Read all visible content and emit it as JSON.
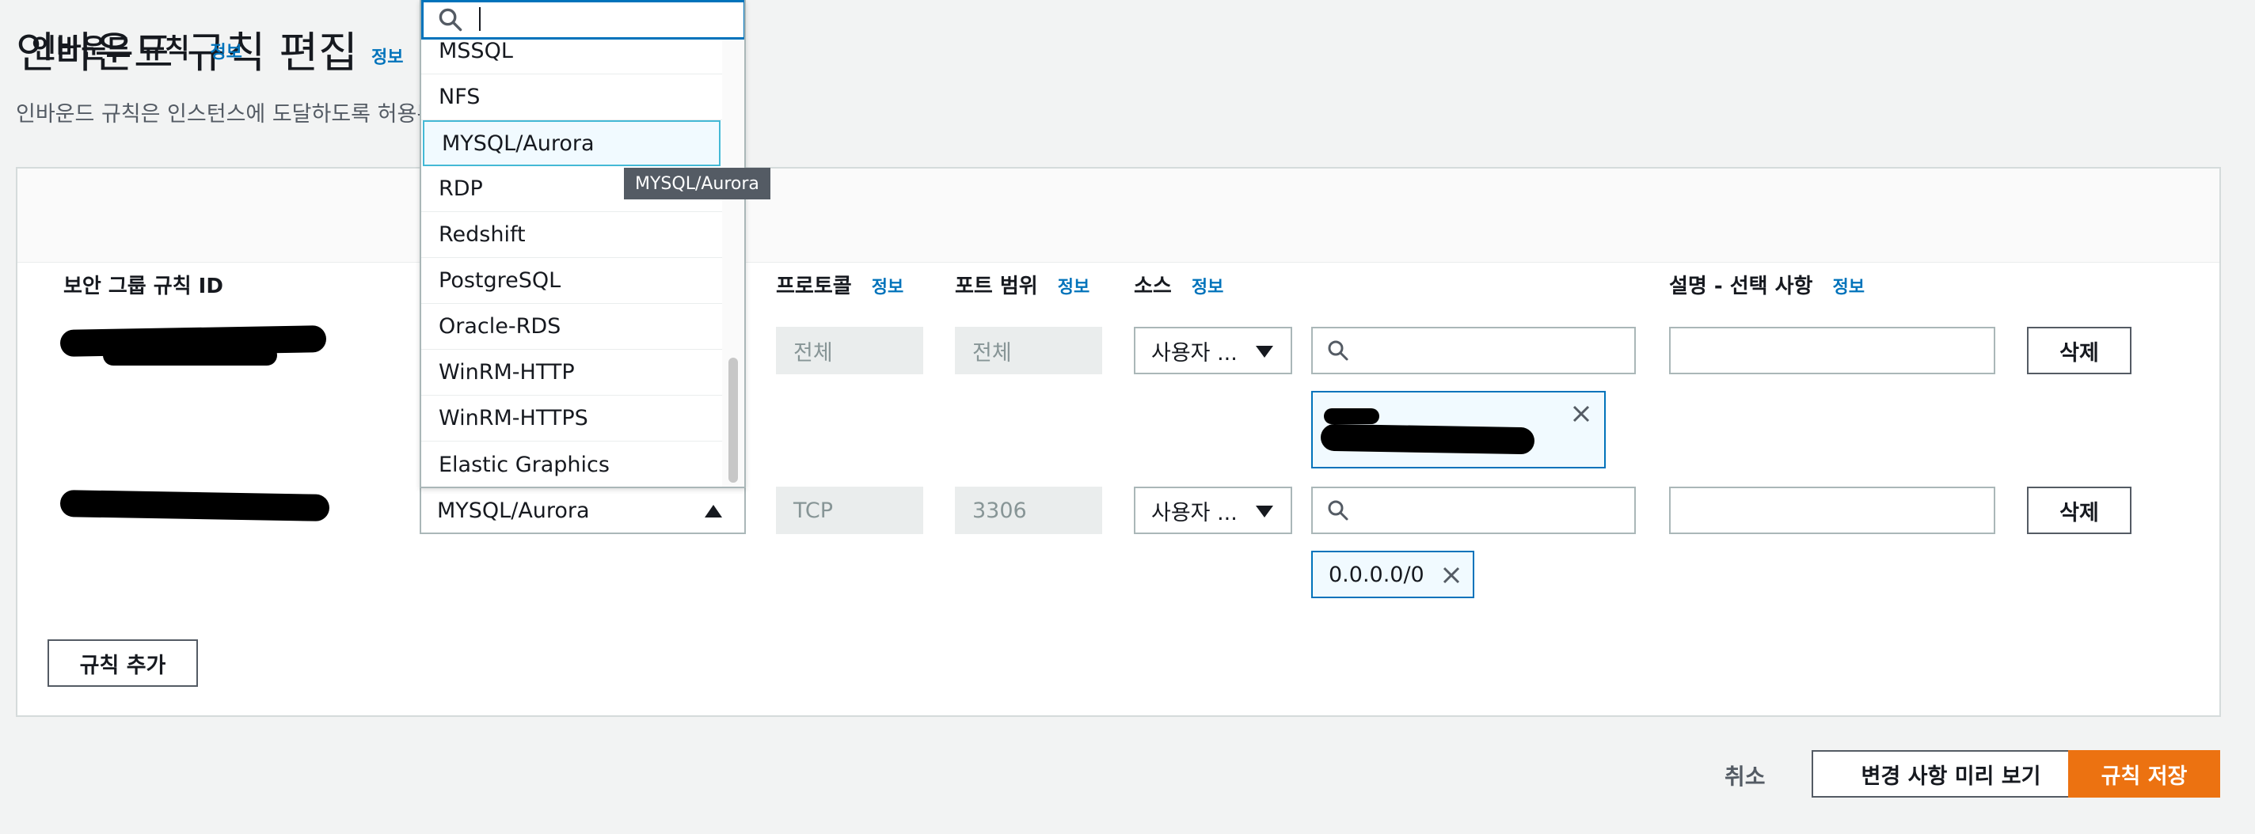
{
  "page": {
    "title": "인바운드 규칙 편집",
    "title_info": "정보",
    "description": "인바운드 규칙은 인스턴스에 도달하도록 허용된"
  },
  "panel": {
    "title": "인바운드 규칙",
    "title_info": "정보"
  },
  "columns": {
    "rule_id": "보안 그룹 규칙 ID",
    "protocol": "프로토콜",
    "protocol_info": "정보",
    "port_range": "포트 범위",
    "port_range_info": "정보",
    "source": "소스",
    "source_info": "정보",
    "description": "설명 - 선택 사항",
    "description_info": "정보"
  },
  "rows": [
    {
      "protocol": "전체",
      "port_range": "전체",
      "source_type": "사용자 ...",
      "source_search": "",
      "description": "",
      "delete_label": "삭제"
    },
    {
      "type": "MYSQL/Aurora",
      "protocol": "TCP",
      "port_range": "3306",
      "source_type": "사용자 ...",
      "source_search": "",
      "token": "0.0.0.0/0",
      "description": "",
      "delete_label": "삭제"
    }
  ],
  "dropdown": {
    "search_value": "",
    "items": [
      "MSSQL",
      "NFS",
      "MYSQL/Aurora",
      "RDP",
      "Redshift",
      "PostgreSQL",
      "Oracle-RDS",
      "WinRM-HTTP",
      "WinRM-HTTPS",
      "Elastic Graphics"
    ],
    "selected": "MYSQL/Aurora",
    "tooltip": "MYSQL/Aurora"
  },
  "actions": {
    "add_rule": "규칙 추가",
    "cancel": "취소",
    "preview": "변경 사항 미리 보기",
    "save": "규칙 저장"
  },
  "colors": {
    "accent": "#0073bb",
    "primary": "#ec7211",
    "background": "#f2f3f3"
  }
}
